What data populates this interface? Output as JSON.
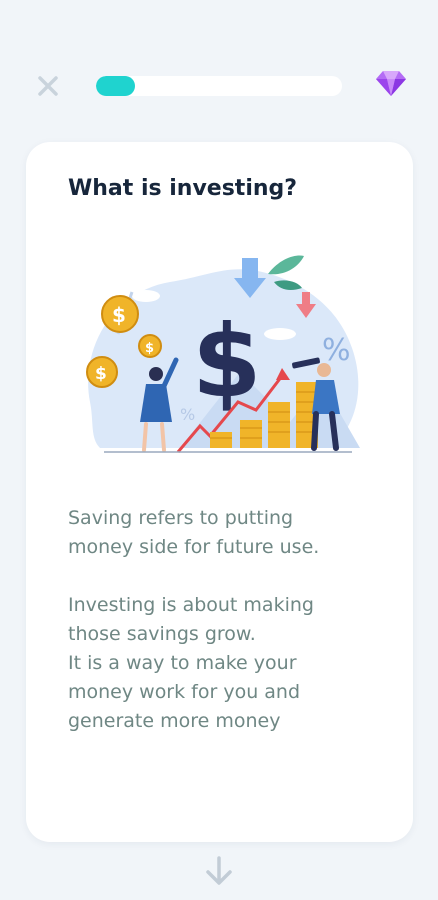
{
  "header": {
    "close_icon": "close-icon",
    "progress": 0.16,
    "progress_color": "#1fd3cf",
    "gem_icon": "gem-icon",
    "gem_color": "#a855f7"
  },
  "card": {
    "title": "What is investing?",
    "illustration": "investing-illustration",
    "paragraphs": [
      {
        "lines": [
          "Saving refers to putting",
          "money side for future use."
        ]
      },
      {
        "lines": [
          "Investing is about making",
          "those savings grow.",
          "It is a way to make your",
          "money work for you and",
          "generate more money"
        ]
      }
    ],
    "text_color": "#6f8784"
  },
  "footer": {
    "arrow_icon": "arrow-down-icon"
  }
}
